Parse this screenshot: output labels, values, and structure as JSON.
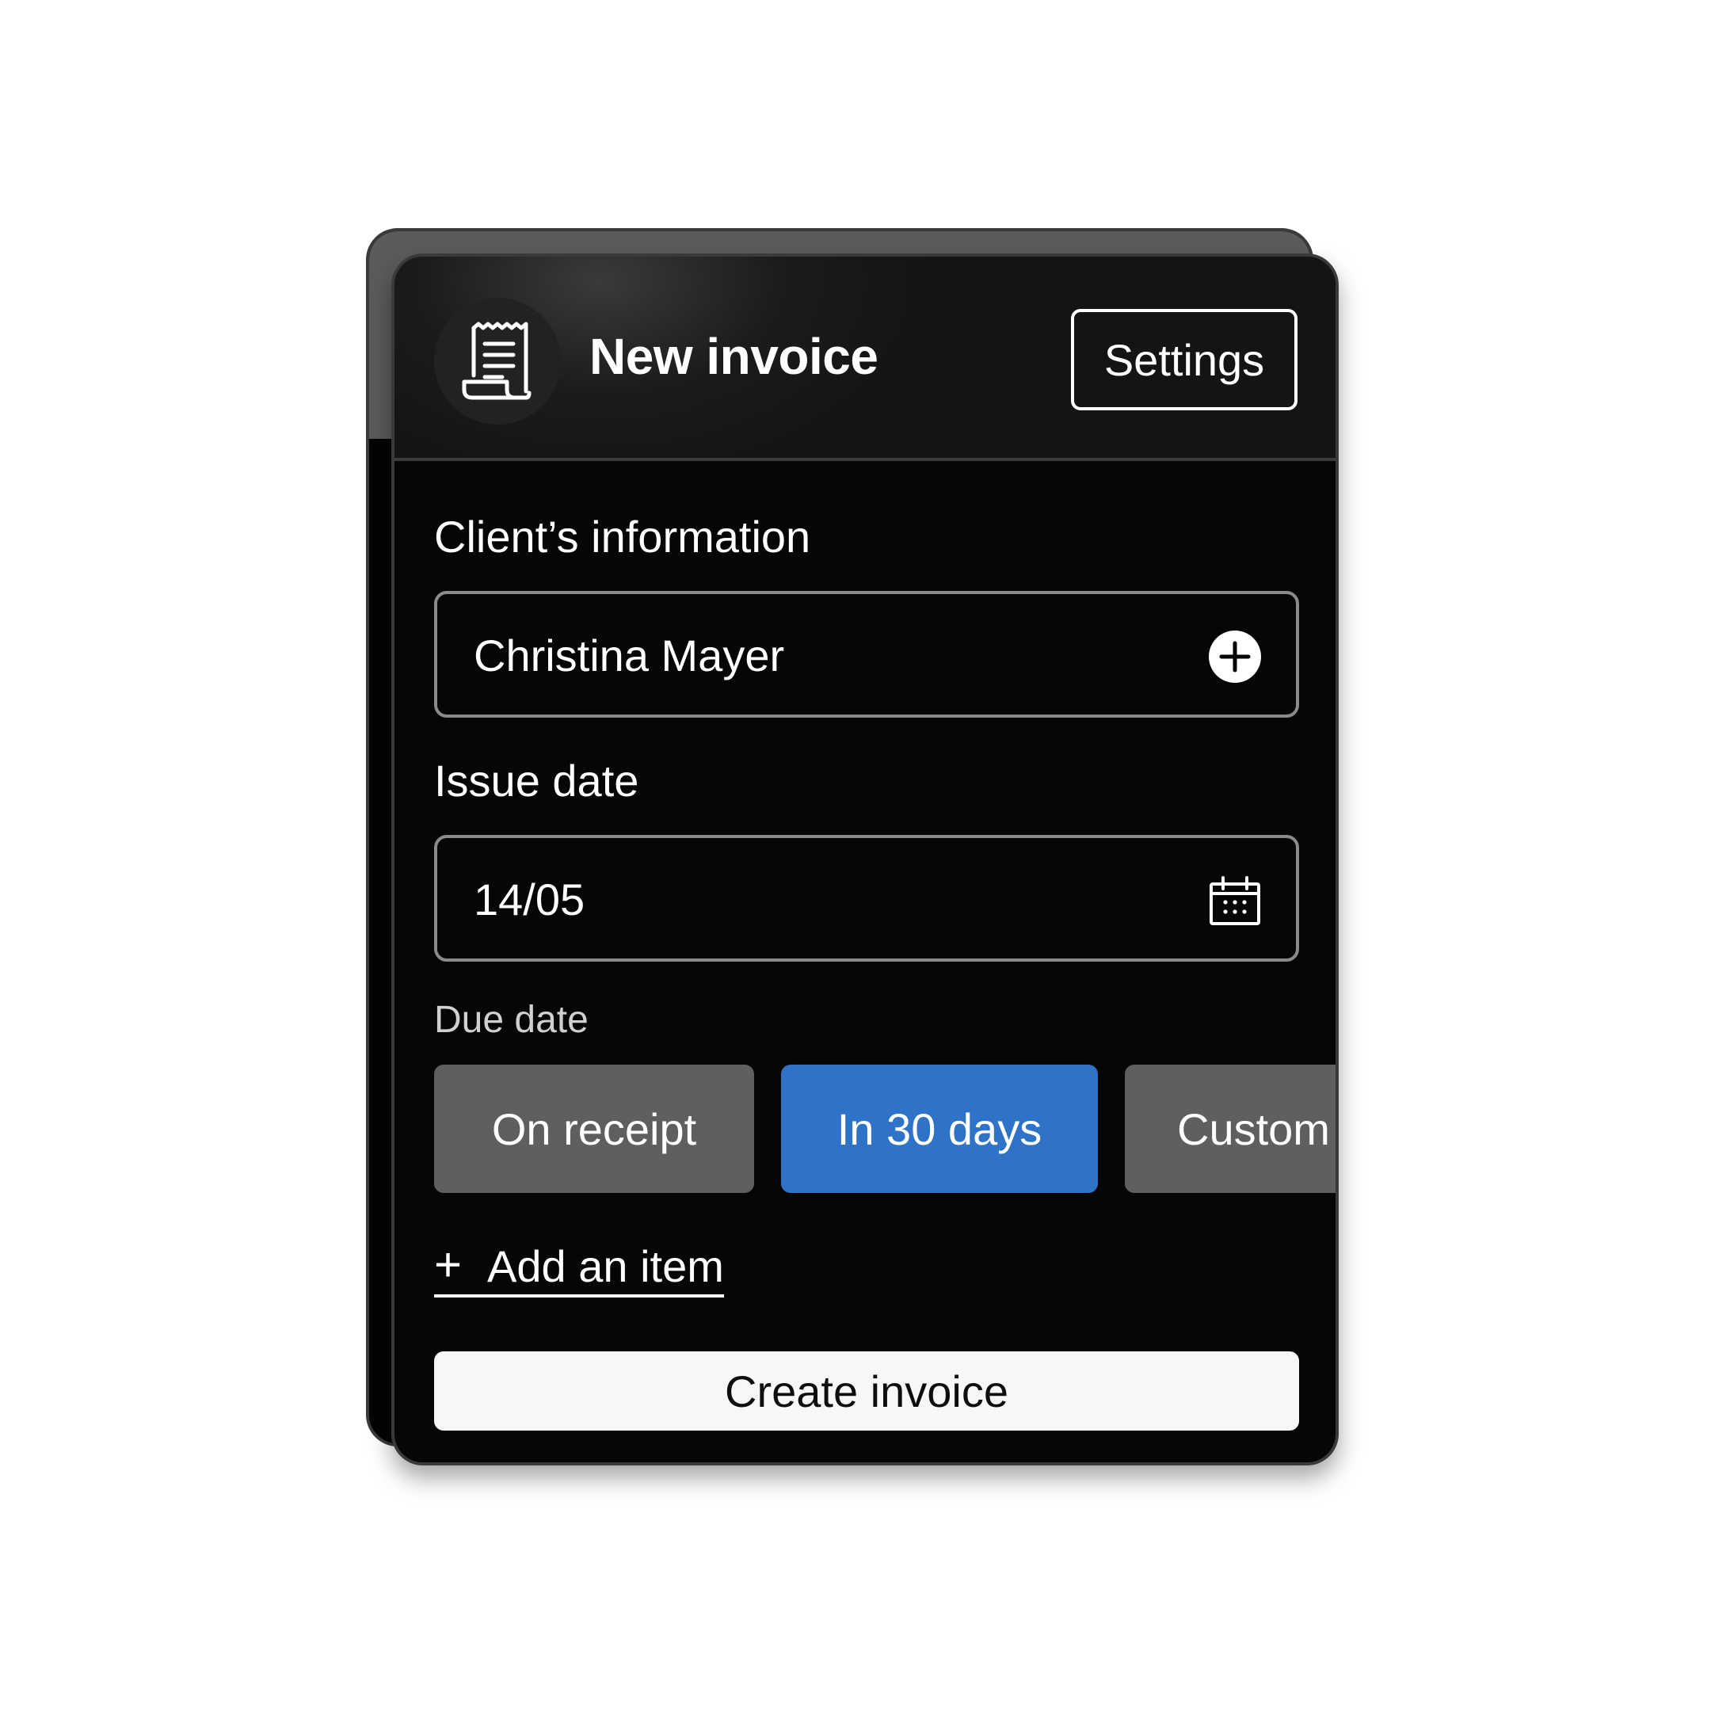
{
  "header": {
    "title": "New invoice",
    "settings_label": "Settings",
    "icon": "receipt-icon"
  },
  "client": {
    "label": "Client’s information",
    "value": "Christina Mayer",
    "action_icon": "add-circle-icon"
  },
  "issue_date": {
    "label": "Issue date",
    "value": "14/05",
    "icon": "calendar-icon"
  },
  "due_date": {
    "label": "Due date",
    "options": [
      {
        "label": "On receipt",
        "selected": false
      },
      {
        "label": "In 30 days",
        "selected": true
      },
      {
        "label": "Custom",
        "selected": false
      }
    ]
  },
  "add_item": {
    "label": "Add an item"
  },
  "create_button": {
    "label": "Create invoice"
  },
  "colors": {
    "accent": "#2f73c8",
    "card_bg": "#060606",
    "chip_bg": "#5f5f5f",
    "primary_button_bg": "#f7f7f7"
  }
}
